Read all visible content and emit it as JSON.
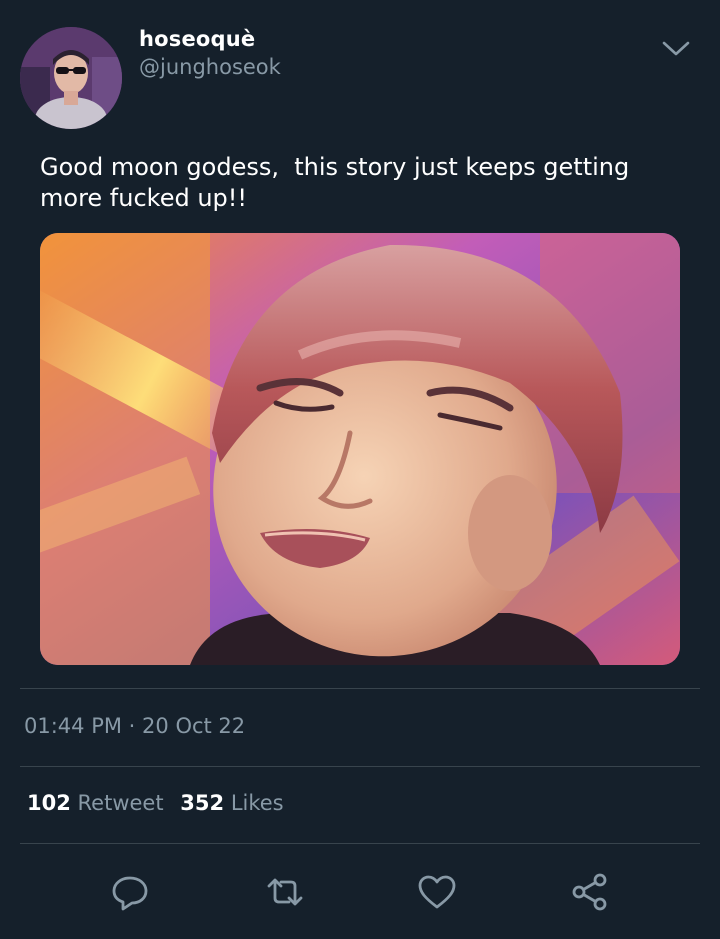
{
  "tweet": {
    "display_name": "hoseoquè",
    "handle": "@junghoseok",
    "text": "Good moon godess,  this story just keeps getting more fucked up!!",
    "time": "01:44 PM",
    "separator": "·",
    "date": "20 Oct 22"
  },
  "stats": {
    "retweet_count": "102",
    "retweet_label": "Retweet",
    "like_count": "352",
    "like_label": "Likes"
  },
  "icons": {
    "menu": "chevron-down-icon",
    "reply": "reply-icon",
    "retweet": "retweet-icon",
    "like": "heart-icon",
    "share": "share-icon"
  },
  "colors": {
    "background": "#15202b",
    "primary_text": "#ffffff",
    "secondary_text": "#8899a6",
    "divider": "#38444d"
  }
}
